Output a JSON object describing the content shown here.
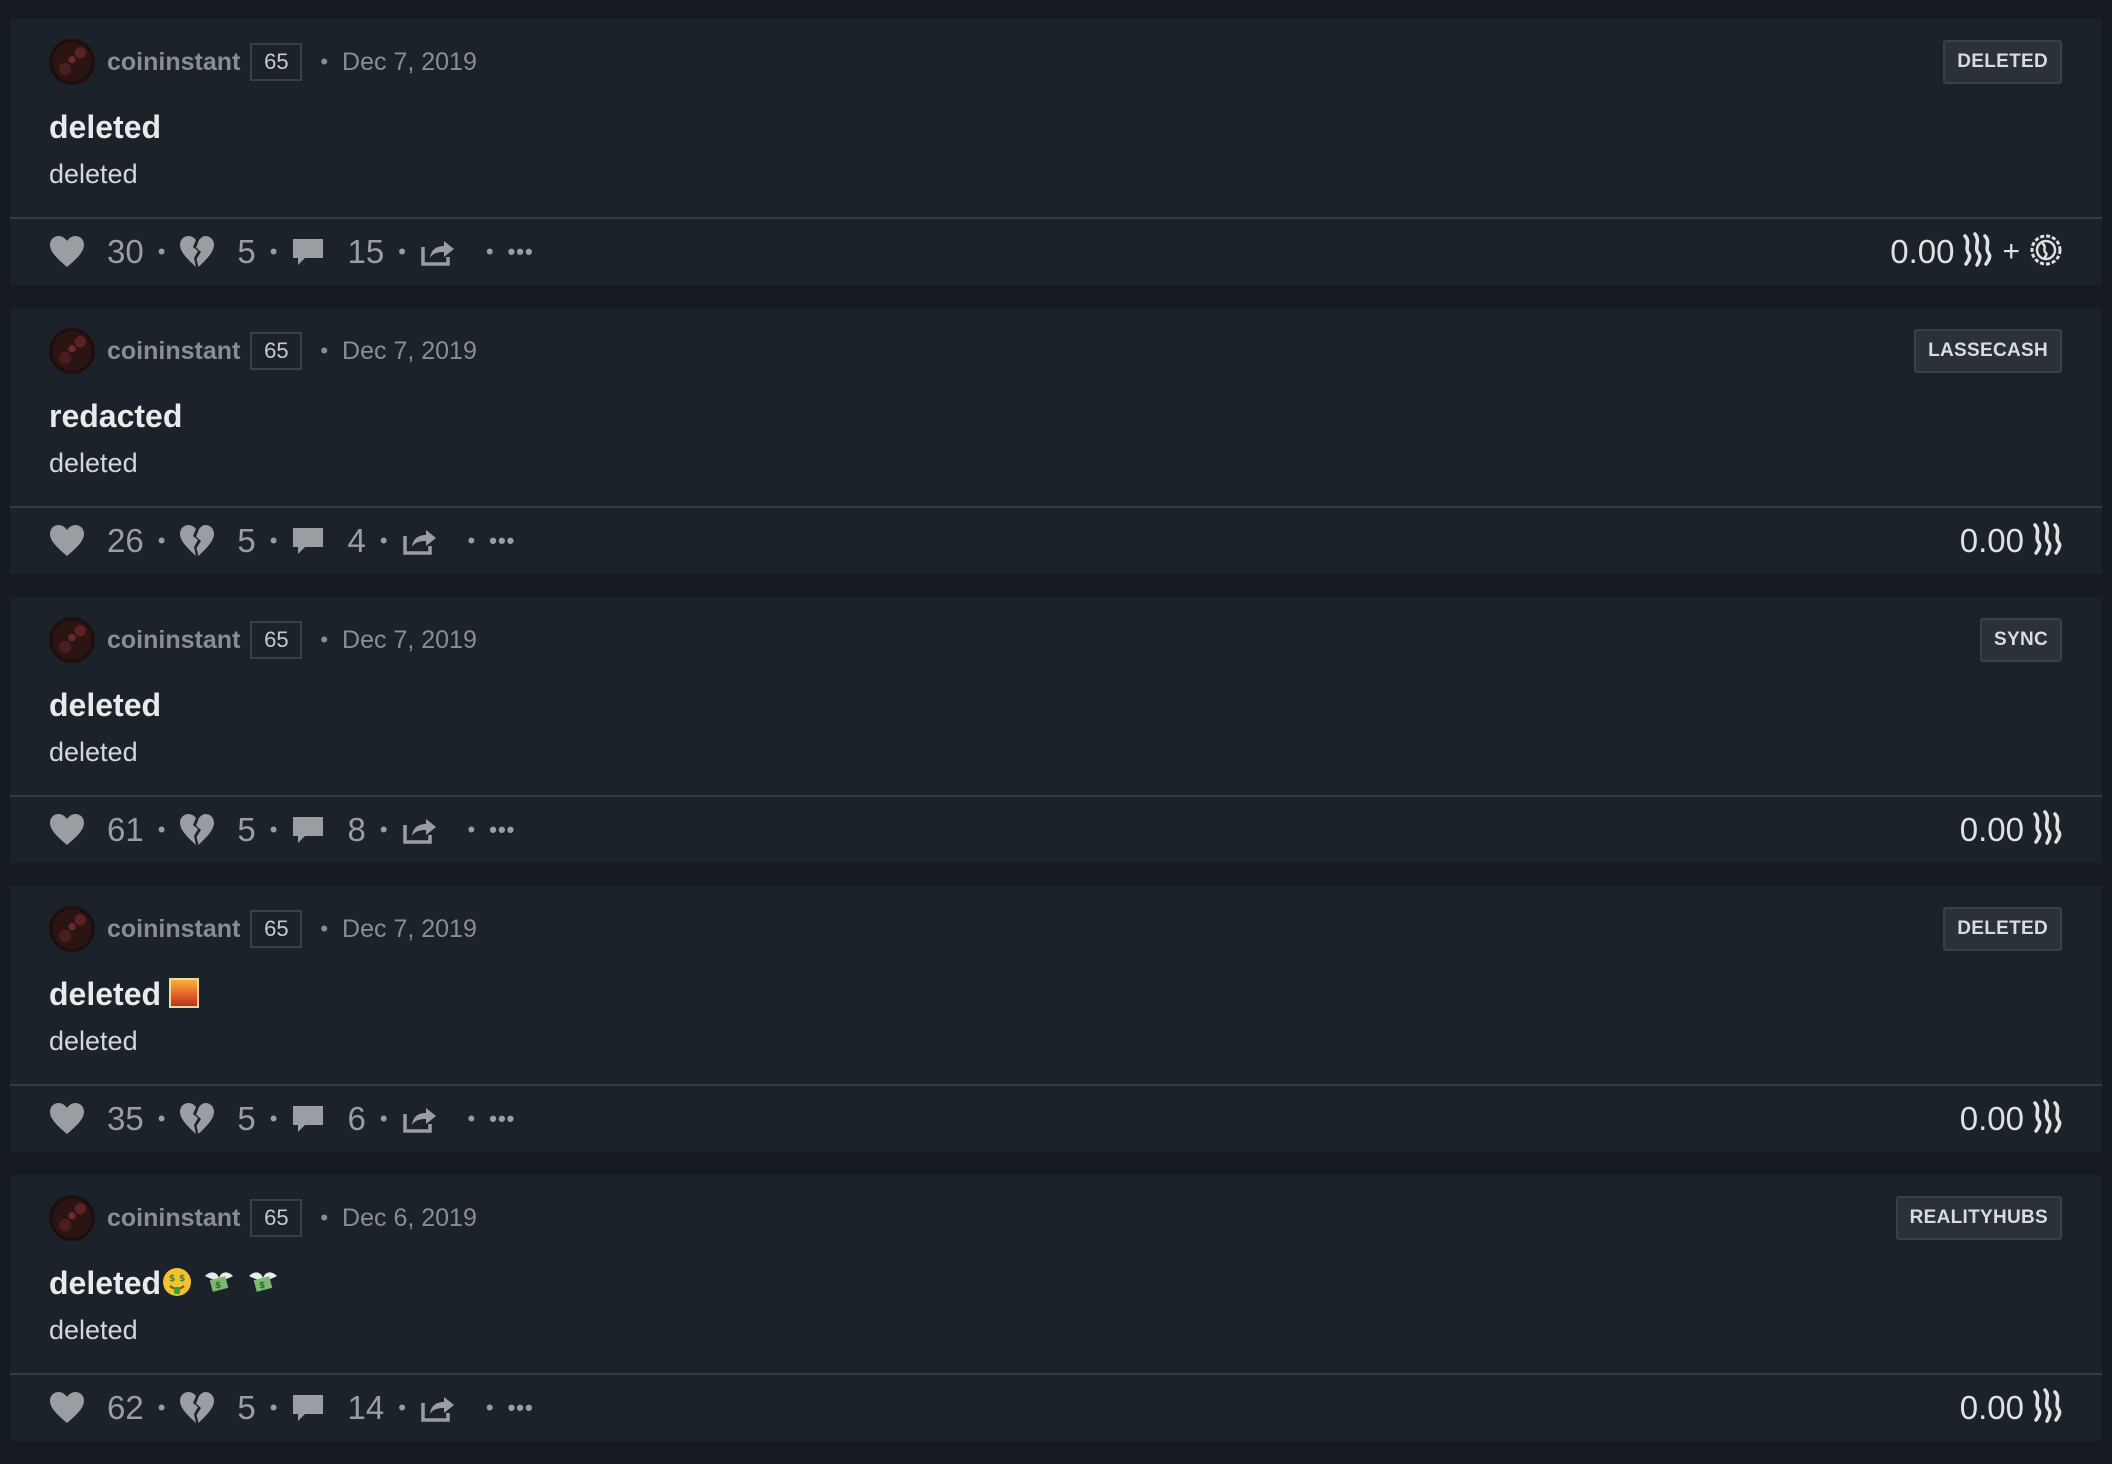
{
  "posts": [
    {
      "author": "coininstant",
      "reputation": "65",
      "date": "Dec 7, 2019",
      "community": "DELETED",
      "title": "deleted",
      "title_emojis": [],
      "body": "deleted",
      "upvotes": "30",
      "downvotes": "5",
      "comments": "15",
      "payout": "0.00",
      "extra_payout_icon": true
    },
    {
      "author": "coininstant",
      "reputation": "65",
      "date": "Dec 7, 2019",
      "community": "LASSECASH",
      "title": "redacted",
      "title_emojis": [],
      "body": "deleted",
      "upvotes": "26",
      "downvotes": "5",
      "comments": "4",
      "payout": "0.00",
      "extra_payout_icon": false
    },
    {
      "author": "coininstant",
      "reputation": "65",
      "date": "Dec 7, 2019",
      "community": "SYNC",
      "title": "deleted",
      "title_emojis": [],
      "body": "deleted",
      "upvotes": "61",
      "downvotes": "5",
      "comments": "8",
      "payout": "0.00",
      "extra_payout_icon": false
    },
    {
      "author": "coininstant",
      "reputation": "65",
      "date": "Dec 7, 2019",
      "community": "DELETED",
      "title": "deleted",
      "title_emojis": [
        "sunset-emoji"
      ],
      "body": "deleted",
      "upvotes": "35",
      "downvotes": "5",
      "comments": "6",
      "payout": "0.00",
      "extra_payout_icon": false
    },
    {
      "author": "coininstant",
      "reputation": "65",
      "date": "Dec 6, 2019",
      "community": "REALITYHUBS",
      "title": "deleted",
      "title_emojis": [
        "money-mouth-face-emoji",
        "money-with-wings-emoji",
        "money-with-wings-emoji"
      ],
      "body": "deleted",
      "upvotes": "62",
      "downvotes": "5",
      "comments": "14",
      "payout": "0.00",
      "extra_payout_icon": false
    }
  ],
  "icons": {
    "upvote": "heart-icon",
    "downvote": "broken-heart-icon",
    "comments": "comment-bubble-icon",
    "share": "share-icon",
    "more": "more-dots-icon",
    "currency": "steem-icon",
    "extra_currency": "steem-power-icon"
  },
  "ui": {
    "separator": "•",
    "more": "•••",
    "plus": "+"
  },
  "colors": {
    "page_bg": "#151b20",
    "card_bg": "#1c2229",
    "muted_text": "#8a8e93",
    "icon": "#9a9ea3"
  }
}
